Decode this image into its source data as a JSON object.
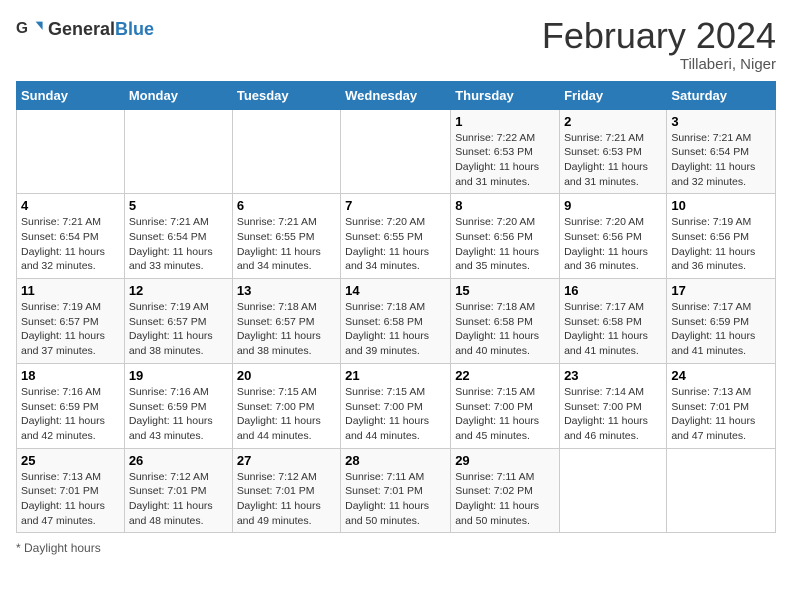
{
  "app": {
    "logo_general": "General",
    "logo_blue": "Blue"
  },
  "header": {
    "title": "February 2024",
    "subtitle": "Tillaberi, Niger"
  },
  "calendar": {
    "days_of_week": [
      "Sunday",
      "Monday",
      "Tuesday",
      "Wednesday",
      "Thursday",
      "Friday",
      "Saturday"
    ],
    "weeks": [
      [
        {
          "day": "",
          "info": ""
        },
        {
          "day": "",
          "info": ""
        },
        {
          "day": "",
          "info": ""
        },
        {
          "day": "",
          "info": ""
        },
        {
          "day": "1",
          "info": "Sunrise: 7:22 AM\nSunset: 6:53 PM\nDaylight: 11 hours and 31 minutes."
        },
        {
          "day": "2",
          "info": "Sunrise: 7:21 AM\nSunset: 6:53 PM\nDaylight: 11 hours and 31 minutes."
        },
        {
          "day": "3",
          "info": "Sunrise: 7:21 AM\nSunset: 6:54 PM\nDaylight: 11 hours and 32 minutes."
        }
      ],
      [
        {
          "day": "4",
          "info": "Sunrise: 7:21 AM\nSunset: 6:54 PM\nDaylight: 11 hours and 32 minutes."
        },
        {
          "day": "5",
          "info": "Sunrise: 7:21 AM\nSunset: 6:54 PM\nDaylight: 11 hours and 33 minutes."
        },
        {
          "day": "6",
          "info": "Sunrise: 7:21 AM\nSunset: 6:55 PM\nDaylight: 11 hours and 34 minutes."
        },
        {
          "day": "7",
          "info": "Sunrise: 7:20 AM\nSunset: 6:55 PM\nDaylight: 11 hours and 34 minutes."
        },
        {
          "day": "8",
          "info": "Sunrise: 7:20 AM\nSunset: 6:56 PM\nDaylight: 11 hours and 35 minutes."
        },
        {
          "day": "9",
          "info": "Sunrise: 7:20 AM\nSunset: 6:56 PM\nDaylight: 11 hours and 36 minutes."
        },
        {
          "day": "10",
          "info": "Sunrise: 7:19 AM\nSunset: 6:56 PM\nDaylight: 11 hours and 36 minutes."
        }
      ],
      [
        {
          "day": "11",
          "info": "Sunrise: 7:19 AM\nSunset: 6:57 PM\nDaylight: 11 hours and 37 minutes."
        },
        {
          "day": "12",
          "info": "Sunrise: 7:19 AM\nSunset: 6:57 PM\nDaylight: 11 hours and 38 minutes."
        },
        {
          "day": "13",
          "info": "Sunrise: 7:18 AM\nSunset: 6:57 PM\nDaylight: 11 hours and 38 minutes."
        },
        {
          "day": "14",
          "info": "Sunrise: 7:18 AM\nSunset: 6:58 PM\nDaylight: 11 hours and 39 minutes."
        },
        {
          "day": "15",
          "info": "Sunrise: 7:18 AM\nSunset: 6:58 PM\nDaylight: 11 hours and 40 minutes."
        },
        {
          "day": "16",
          "info": "Sunrise: 7:17 AM\nSunset: 6:58 PM\nDaylight: 11 hours and 41 minutes."
        },
        {
          "day": "17",
          "info": "Sunrise: 7:17 AM\nSunset: 6:59 PM\nDaylight: 11 hours and 41 minutes."
        }
      ],
      [
        {
          "day": "18",
          "info": "Sunrise: 7:16 AM\nSunset: 6:59 PM\nDaylight: 11 hours and 42 minutes."
        },
        {
          "day": "19",
          "info": "Sunrise: 7:16 AM\nSunset: 6:59 PM\nDaylight: 11 hours and 43 minutes."
        },
        {
          "day": "20",
          "info": "Sunrise: 7:15 AM\nSunset: 7:00 PM\nDaylight: 11 hours and 44 minutes."
        },
        {
          "day": "21",
          "info": "Sunrise: 7:15 AM\nSunset: 7:00 PM\nDaylight: 11 hours and 44 minutes."
        },
        {
          "day": "22",
          "info": "Sunrise: 7:15 AM\nSunset: 7:00 PM\nDaylight: 11 hours and 45 minutes."
        },
        {
          "day": "23",
          "info": "Sunrise: 7:14 AM\nSunset: 7:00 PM\nDaylight: 11 hours and 46 minutes."
        },
        {
          "day": "24",
          "info": "Sunrise: 7:13 AM\nSunset: 7:01 PM\nDaylight: 11 hours and 47 minutes."
        }
      ],
      [
        {
          "day": "25",
          "info": "Sunrise: 7:13 AM\nSunset: 7:01 PM\nDaylight: 11 hours and 47 minutes."
        },
        {
          "day": "26",
          "info": "Sunrise: 7:12 AM\nSunset: 7:01 PM\nDaylight: 11 hours and 48 minutes."
        },
        {
          "day": "27",
          "info": "Sunrise: 7:12 AM\nSunset: 7:01 PM\nDaylight: 11 hours and 49 minutes."
        },
        {
          "day": "28",
          "info": "Sunrise: 7:11 AM\nSunset: 7:01 PM\nDaylight: 11 hours and 50 minutes."
        },
        {
          "day": "29",
          "info": "Sunrise: 7:11 AM\nSunset: 7:02 PM\nDaylight: 11 hours and 50 minutes."
        },
        {
          "day": "",
          "info": ""
        },
        {
          "day": "",
          "info": ""
        }
      ]
    ]
  },
  "footer": {
    "text": "Daylight hours"
  }
}
